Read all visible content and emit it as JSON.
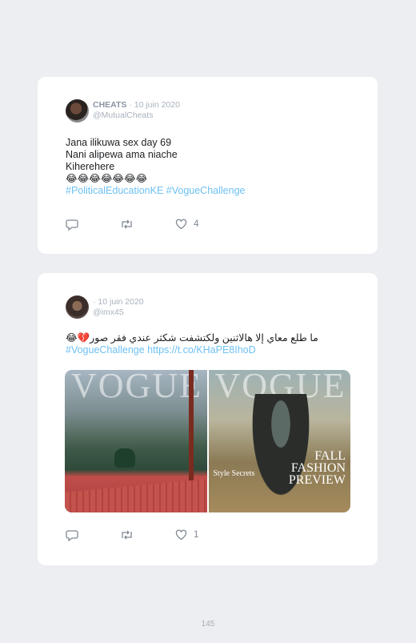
{
  "tweets": [
    {
      "name": "CHEATS",
      "date": "· 10 juin 2020",
      "handle": "@MutualCheats",
      "lines": [
        "Jana ilikuwa sex day 69",
        "Nani alipewa ama niache",
        "Kiherehere",
        "😂😂😂😂😂😂😂"
      ],
      "hashtags": "#PoliticalEducationKE #VogueChallenge",
      "reply_icon": "reply-icon",
      "retweet_icon": "retweet-icon",
      "like_icon": "heart-icon",
      "like_count": "4"
    },
    {
      "name": "",
      "date": "· 10 juin 2020",
      "handle": "@imx45",
      "lines": [
        "ما طلع معاي إلا هالاثنين ولكتشفت شكثر عندي فقر صور💔😂"
      ],
      "hashtags": "#VogueChallenge https://t.co/KHaPE8IhoD",
      "media": {
        "left_title": "VOGUE",
        "right_title": "VOGUE",
        "right_caption": [
          "FALL",
          "FASHION",
          "PREVIEW"
        ],
        "right_subcaption": "Style Secrets"
      },
      "reply_icon": "reply-icon",
      "retweet_icon": "retweet-icon",
      "like_icon": "heart-icon",
      "like_count": "1"
    }
  ],
  "page_number": "145",
  "colors": {
    "background": "#eceef1",
    "card": "#ffffff",
    "link": "#6ec1f2",
    "muted": "#a9b2bd"
  }
}
